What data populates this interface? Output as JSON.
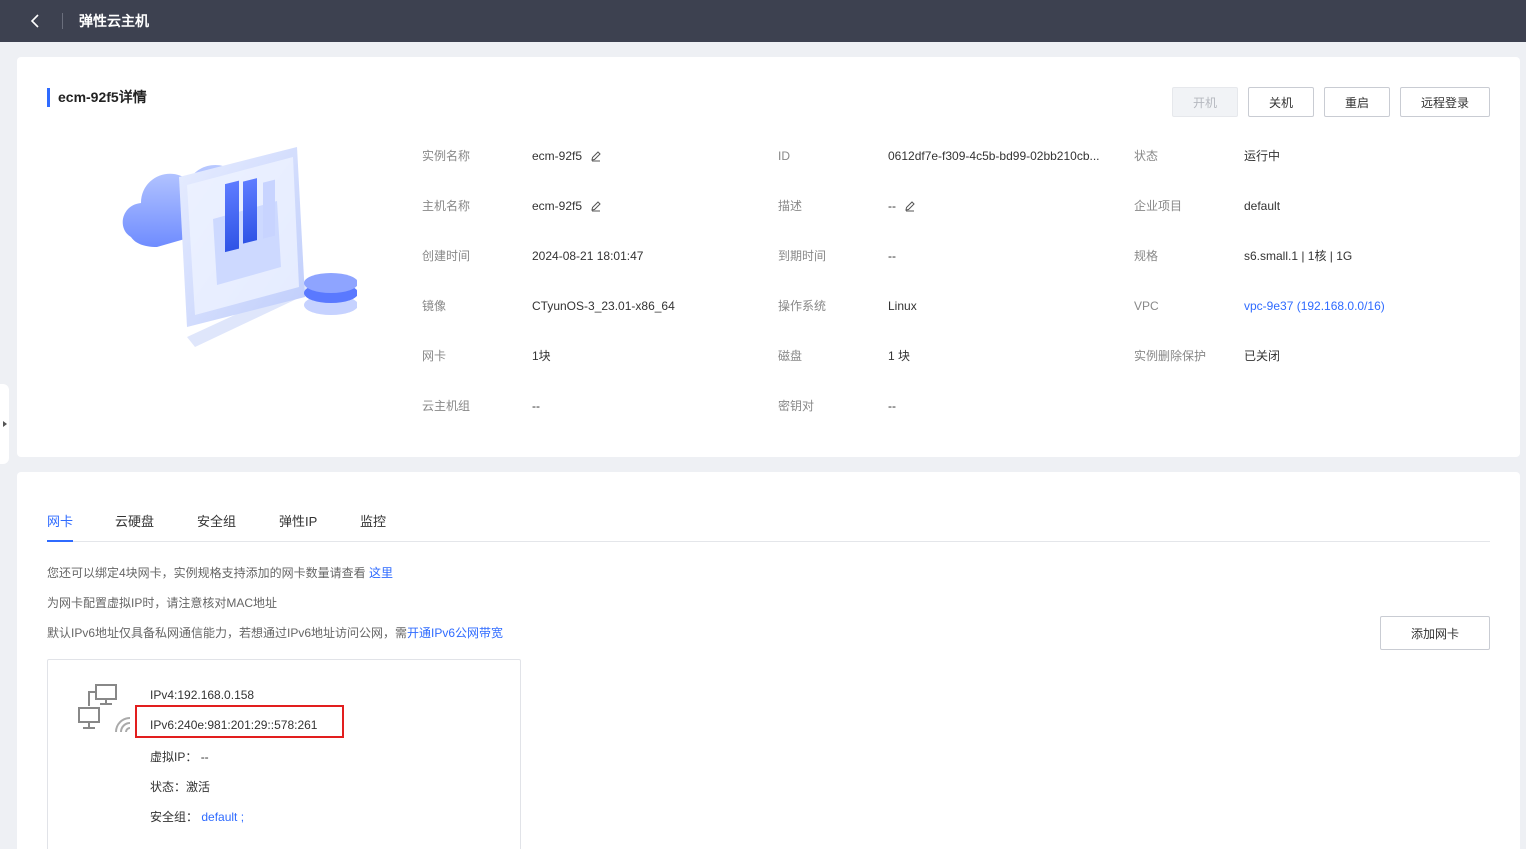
{
  "topbar": {
    "title": "弹性云主机"
  },
  "detail": {
    "title": "ecm-92f5详情",
    "actions": {
      "power_on": "开机",
      "power_off": "关机",
      "restart": "重启",
      "remote_login": "远程登录"
    },
    "fields": {
      "instance_name_label": "实例名称",
      "instance_name": "ecm-92f5",
      "id_label": "ID",
      "id": "0612df7e-f309-4c5b-bd99-02bb210cb...",
      "status_label": "状态",
      "status": "运行中",
      "host_name_label": "主机名称",
      "host_name": "ecm-92f5",
      "description_label": "描述",
      "description": "--",
      "enterprise_project_label": "企业项目",
      "enterprise_project": "default",
      "created_label": "创建时间",
      "created": "2024-08-21 18:01:47",
      "expire_label": "到期时间",
      "expire": "--",
      "spec_label": "规格",
      "spec": "s6.small.1 | 1核 | 1G",
      "image_label": "镜像",
      "image": "CTyunOS-3_23.01-x86_64",
      "os_label": "操作系统",
      "os": "Linux",
      "vpc_label": "VPC",
      "vpc": "vpc-9e37 (192.168.0.0/16)",
      "nic_label": "网卡",
      "nic": "1块",
      "disk_label": "磁盘",
      "disk": "1 块",
      "delete_protect_label": "实例删除保护",
      "delete_protect": "已关闭",
      "host_group_label": "云主机组",
      "host_group": "--",
      "keypair_label": "密钥对",
      "keypair": "--"
    }
  },
  "tabs": [
    {
      "label": "网卡"
    },
    {
      "label": "云硬盘"
    },
    {
      "label": "安全组"
    },
    {
      "label": "弹性IP"
    },
    {
      "label": "监控"
    }
  ],
  "notes": {
    "line1": "您还可以绑定4块网卡，实例规格支持添加的网卡数量请查看 ",
    "line1_link": "这里",
    "line2": "为网卡配置虚拟IP时，请注意核对MAC地址",
    "line3": "默认IPv6地址仅具备私网通信能力，若想通过IPv6地址访问公网，需",
    "line3_link": "开通IPv6公网带宽"
  },
  "add_nic_label": "添加网卡",
  "nic_card": {
    "ipv4": "IPv4:192.168.0.158",
    "ipv6": "IPv6:240e:981:201:29::578:261",
    "virtual_ip_label": "虚拟IP：",
    "virtual_ip": "--",
    "status": "状态：激活",
    "security_group_label": "安全组：",
    "security_group": "default ;"
  },
  "colors": {
    "accent": "#2f6bff",
    "topbar": "#3d4150",
    "highlight": "#e21e1e"
  }
}
